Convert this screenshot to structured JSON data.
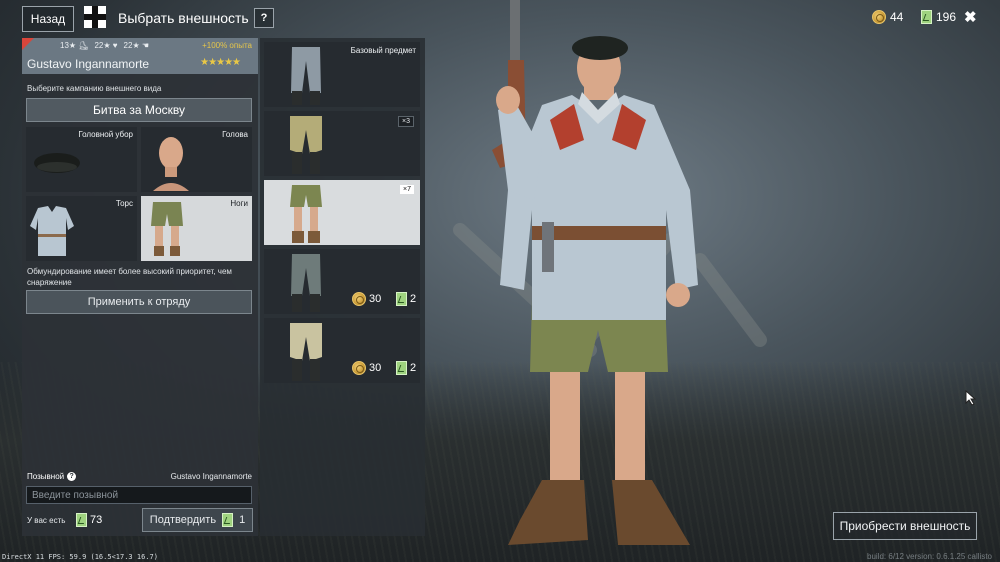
{
  "topbar": {
    "back_label": "Назад",
    "title": "Выбрать внешность",
    "help_label": "?",
    "silver": "44",
    "orders": "196",
    "close_label": "✖"
  },
  "soldier": {
    "stat_1": "13",
    "stat_2": "22",
    "stat_3": "22",
    "exp_bonus": "+100% опыта",
    "name": "Gustavo Ingannamorte",
    "stars": "★★★★★"
  },
  "campaign": {
    "prompt": "Выберите кампанию внешнего вида",
    "selected": "Битва за Москву"
  },
  "slots": {
    "headgear": "Головной убор",
    "head": "Голова",
    "torso": "Торс",
    "legs": "Ноги"
  },
  "notes": {
    "priority": "Обмундирование имеет более высокий приоритет, чем снаряжение"
  },
  "apply_label": "Применить к отряду",
  "callsign": {
    "label": "Позывной",
    "current": "Gustavo Ingannamorte",
    "placeholder": "Введите позывной",
    "have_label": "У вас есть",
    "have_count": "73",
    "confirm_label": "Подтвердить",
    "confirm_cost": "1"
  },
  "items": [
    {
      "title": "Базовый предмет"
    },
    {
      "count": "×3"
    },
    {
      "count": "×7"
    },
    {
      "price_silver": "30",
      "price_orders": "2"
    },
    {
      "price_silver": "30",
      "price_orders": "2"
    }
  ],
  "buy_label": "Приобрести внешность",
  "footer": {
    "fps": "DirectX 11 FPS: 59.9 (16.5<17.3 16.7)",
    "build": "build: 6/12 version: 0.6.1.25 callisto"
  },
  "colors": {
    "accent_gold": "#e9c846",
    "order_green": "#9fd37f",
    "panel_header": "#6b7883"
  }
}
